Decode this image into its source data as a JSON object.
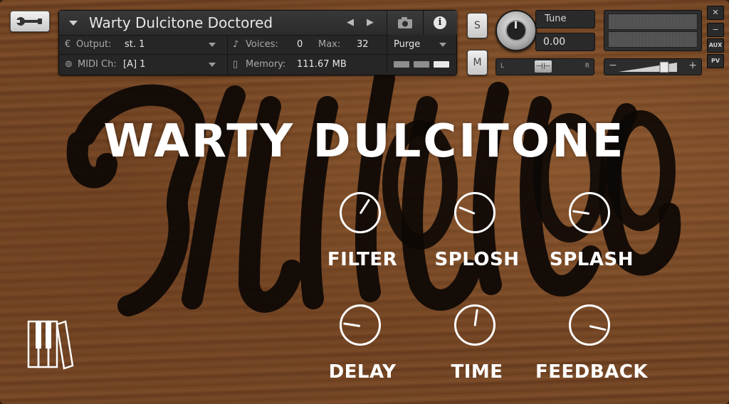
{
  "instrument": {
    "name": "Warty Dulcitone Doctored",
    "output_label": "Output:",
    "output_value": "st. 1",
    "voices_label": "Voices:",
    "voices_value": "0",
    "max_label": "Max:",
    "max_value": "32",
    "purge_label": "Purge",
    "midi_label": "MIDI Ch:",
    "midi_value": "[A]  1",
    "memory_label": "Memory:",
    "memory_value": "111.67 MB"
  },
  "side_controls": {
    "solo": "S",
    "mute": "M",
    "tune_label": "Tune",
    "tune_value": "0.00",
    "pan_left": "L",
    "pan_right": "R",
    "vol_minus": "−",
    "vol_plus": "+",
    "aux": "AUX",
    "pv": "PV",
    "close": "✕",
    "minimize": "−"
  },
  "panel": {
    "title": "WARTY DULCITONE",
    "knobs": [
      {
        "label": "FILTER",
        "value": 0.62
      },
      {
        "label": "SPLOSH",
        "value": 0.25
      },
      {
        "label": "SPLASH",
        "value": 0.2
      },
      {
        "label": "DELAY",
        "value": 0.2
      },
      {
        "label": "TIME",
        "value": 0.53
      },
      {
        "label": "FEEDBACK",
        "value": 0.88
      }
    ]
  },
  "colors": {
    "accent_text": "#ffffff",
    "header_bg": "#262626"
  }
}
